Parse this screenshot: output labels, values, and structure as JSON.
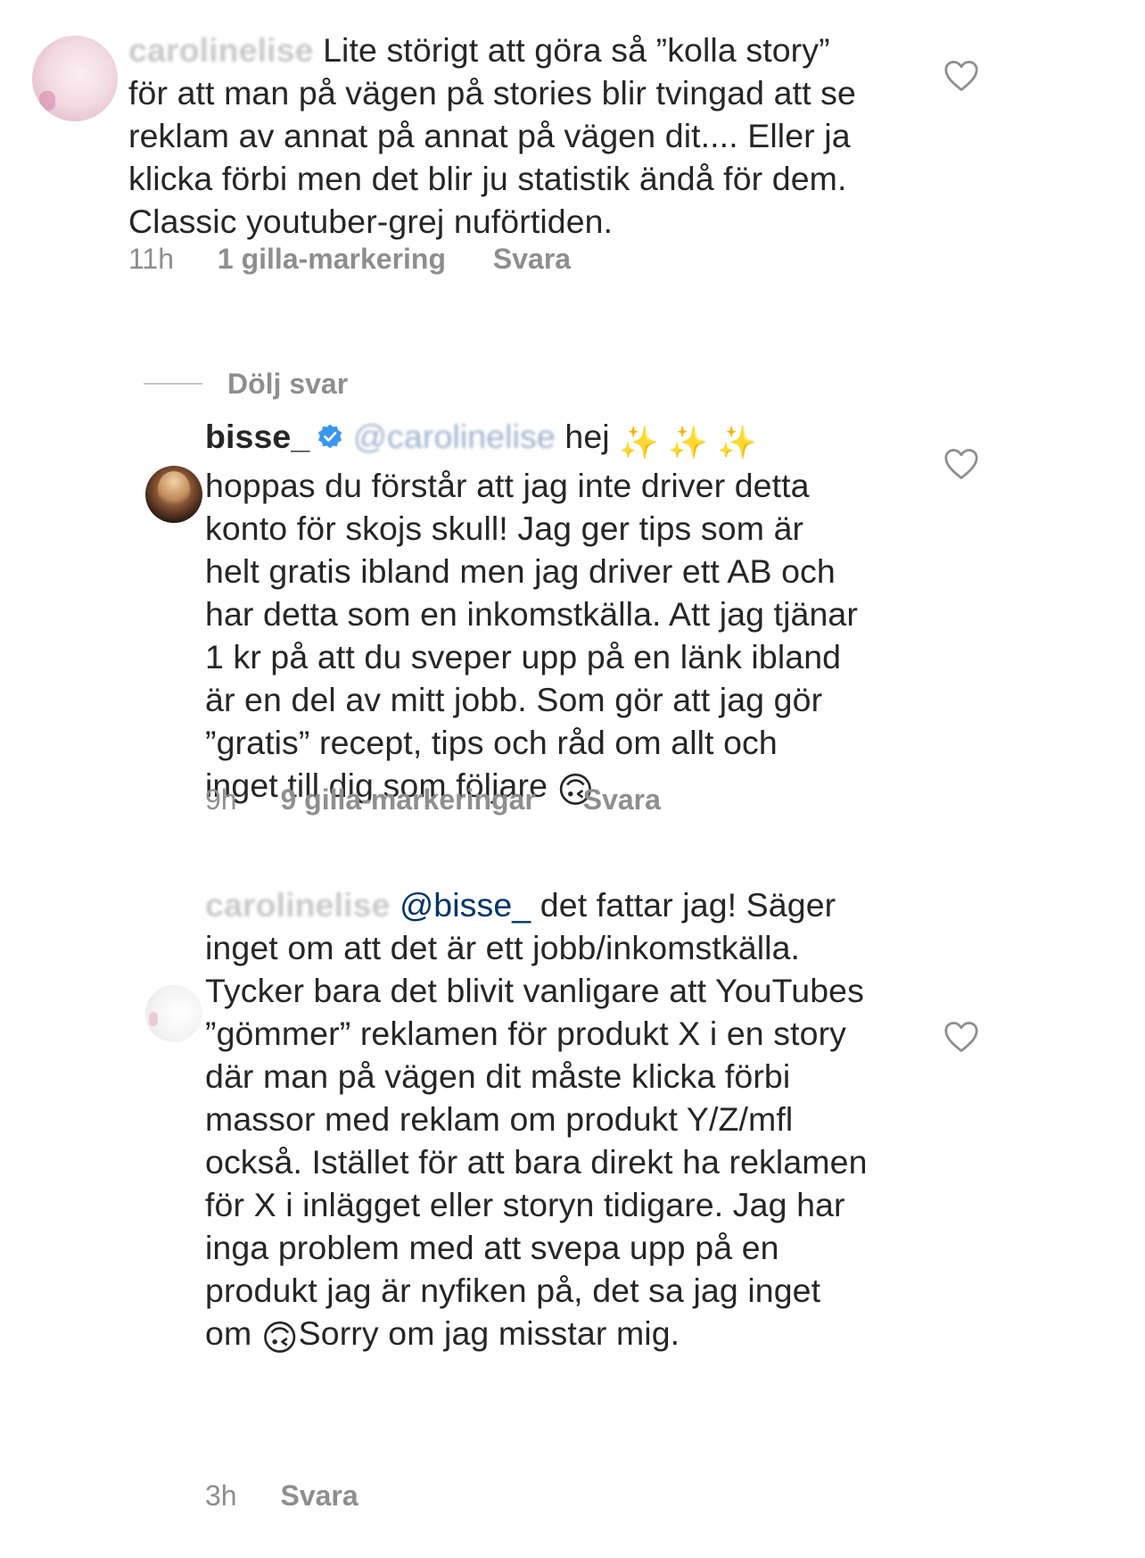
{
  "comments": [
    {
      "username": "carolinelise",
      "username_blurred": true,
      "text_line1": " Lite störigt att göra så ”kolla story”",
      "text_rest": "för att man på vägen på stories blir tvingad att se\nreklam av annat på annat på vägen dit.... Eller ja\nklicka förbi men det blir ju statistik ändå för dem.\nClassic youtuber-grej nuförtiden.",
      "time": "11h",
      "likes": "1 gilla-markering",
      "reply": "Svara",
      "heart_icon": "heart-outline-icon"
    },
    {
      "username": "bisse_",
      "verified_icon": "verified-badge-icon",
      "mention": "@carolinelise",
      "mention_blurred": true,
      "text_line1": " hej ",
      "sparkles": "✨ ✨ ✨",
      "text_rest": "hoppas du förstår att jag inte driver detta\nkonto för skojs skull! Jag ger tips som är\nhelt gratis ibland men jag driver ett AB och\nhar detta som en inkomstkälla. Att jag tjänar\n1 kr på att du sveper upp på en länk ibland\när en del av mitt jobb. Som gör att jag gör\n”gratis” recept, tips och råd om allt och\ninget till dig som följare ",
      "emoji_end": "🙃",
      "time": "9h",
      "likes": "9 gilla-markeringar",
      "reply": "Svara",
      "heart_icon": "heart-outline-icon"
    },
    {
      "username": "carolinelise",
      "username_blurred": true,
      "mention": "@bisse_",
      "text_line1": " det fattar jag! Säger",
      "text_rest": "inget om att det är ett jobb/inkomstkälla.\nTycker bara det blivit vanligare att YouTubes\n”gömmer” reklamen för produkt X i en story\ndär man på vägen dit måste klicka förbi\nmassor med reklam om produkt Y/Z/mfl\nockså. Istället för att bara direkt ha reklamen\nför X i inlägget eller storyn tidigare. Jag har\ninga problem med att svepa upp på en\nprodukt jag är nyfiken på, det sa jag inget\nom ",
      "emoji_mid": "🙃",
      "text_tail": "Sorry om jag misstar mig.",
      "time": "3h",
      "reply": "Svara",
      "heart_icon": "heart-outline-icon"
    }
  ],
  "hide_replies": {
    "label": "Dölj svar"
  },
  "colors": {
    "text": "#262626",
    "meta": "#8e8e8e",
    "mention": "#003569",
    "verified": "#3897f0"
  }
}
